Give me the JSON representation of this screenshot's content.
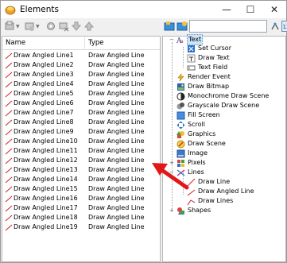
{
  "window": {
    "title": "Elements"
  },
  "titlebar": {
    "minimize": "—",
    "maximize": "☐",
    "close": "✕"
  },
  "search": {
    "value": "",
    "placeholder": ""
  },
  "list": {
    "columns": [
      "Name",
      "Type"
    ],
    "rows": [
      {
        "name": "Draw Angled Line1",
        "type": "Draw Angled Line"
      },
      {
        "name": "Draw Angled Line2",
        "type": "Draw Angled Line"
      },
      {
        "name": "Draw Angled Line3",
        "type": "Draw Angled Line"
      },
      {
        "name": "Draw Angled Line4",
        "type": "Draw Angled Line"
      },
      {
        "name": "Draw Angled Line5",
        "type": "Draw Angled Line"
      },
      {
        "name": "Draw Angled Line6",
        "type": "Draw Angled Line"
      },
      {
        "name": "Draw Angled Line7",
        "type": "Draw Angled Line"
      },
      {
        "name": "Draw Angled Line8",
        "type": "Draw Angled Line"
      },
      {
        "name": "Draw Angled Line9",
        "type": "Draw Angled Line"
      },
      {
        "name": "Draw Angled Line10",
        "type": "Draw Angled Line"
      },
      {
        "name": "Draw Angled Line11",
        "type": "Draw Angled Line"
      },
      {
        "name": "Draw Angled Line12",
        "type": "Draw Angled Line"
      },
      {
        "name": "Draw Angled Line13",
        "type": "Draw Angled Line"
      },
      {
        "name": "Draw Angled Line14",
        "type": "Draw Angled Line"
      },
      {
        "name": "Draw Angled Line15",
        "type": "Draw Angled Line"
      },
      {
        "name": "Draw Angled Line16",
        "type": "Draw Angled Line"
      },
      {
        "name": "Draw Angled Line17",
        "type": "Draw Angled Line"
      },
      {
        "name": "Draw Angled Line18",
        "type": "Draw Angled Line"
      },
      {
        "name": "Draw Angled Line19",
        "type": "Draw Angled Line"
      }
    ]
  },
  "tree": {
    "text": "Text",
    "set_cursor": "Set Cursor",
    "draw_text": "Draw Text",
    "text_field": "Text Field",
    "render_event": "Render Event",
    "draw_bitmap": "Draw Bitmap",
    "monochrome": "Monochrome Draw Scene",
    "grayscale": "Grayscale Draw Scene",
    "fill_screen": "Fill Screen",
    "scroll": "Scroll",
    "graphics": "Graphics",
    "draw_scene": "Draw Scene",
    "image": "Image",
    "pixels": "Pixels",
    "lines": "Lines",
    "draw_line": "Draw Line",
    "draw_angled_line": "Draw Angled Line",
    "draw_lines": "Draw Lines",
    "shapes": "Shapes",
    "expanded": "−",
    "collapsed": "+"
  },
  "colors": {
    "selection": "#cce4f7",
    "arrow": "#e01818",
    "line_icon": "#d02020"
  }
}
